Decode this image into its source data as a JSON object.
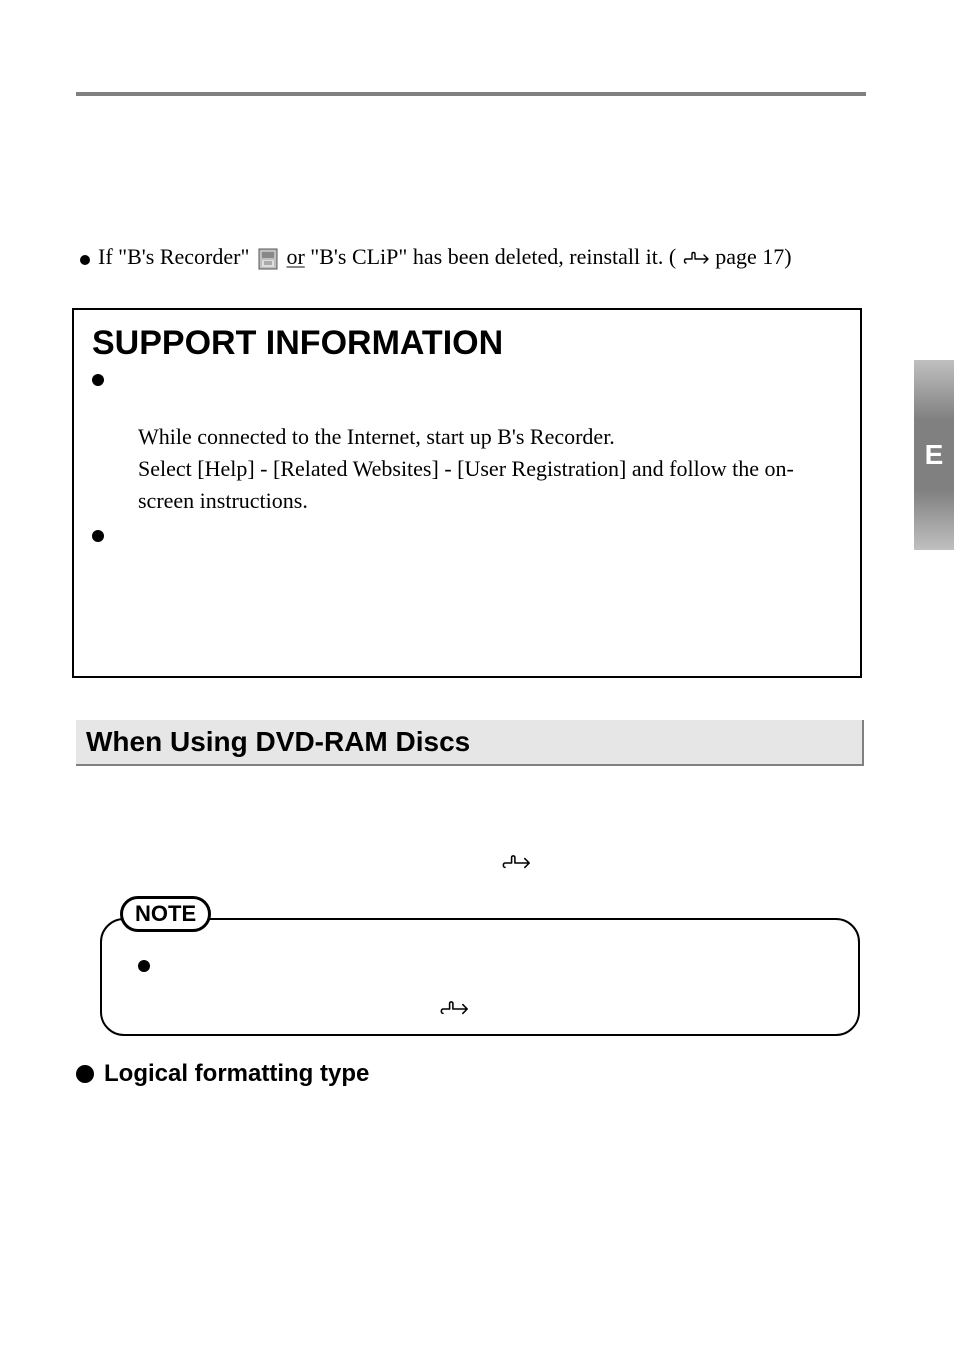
{
  "sideTab": {
    "letter": "E"
  },
  "line1": {
    "prefix": "If \"B's Recorder\"",
    "mid": "or",
    "suffix": "\"B's CLiP\" has been deleted, reinstall it. (",
    "pageRef": " page 17)"
  },
  "support": {
    "title": "SUPPORT INFORMATION",
    "body": "While connected to the Internet, start up B's Recorder.\nSelect [Help] - [Related Websites] - [User Registration] and follow the on-screen instructions."
  },
  "section": {
    "title": "When Using DVD-RAM Discs"
  },
  "note": {
    "label": "NOTE"
  },
  "subheading": {
    "text": "Logical formatting type"
  }
}
